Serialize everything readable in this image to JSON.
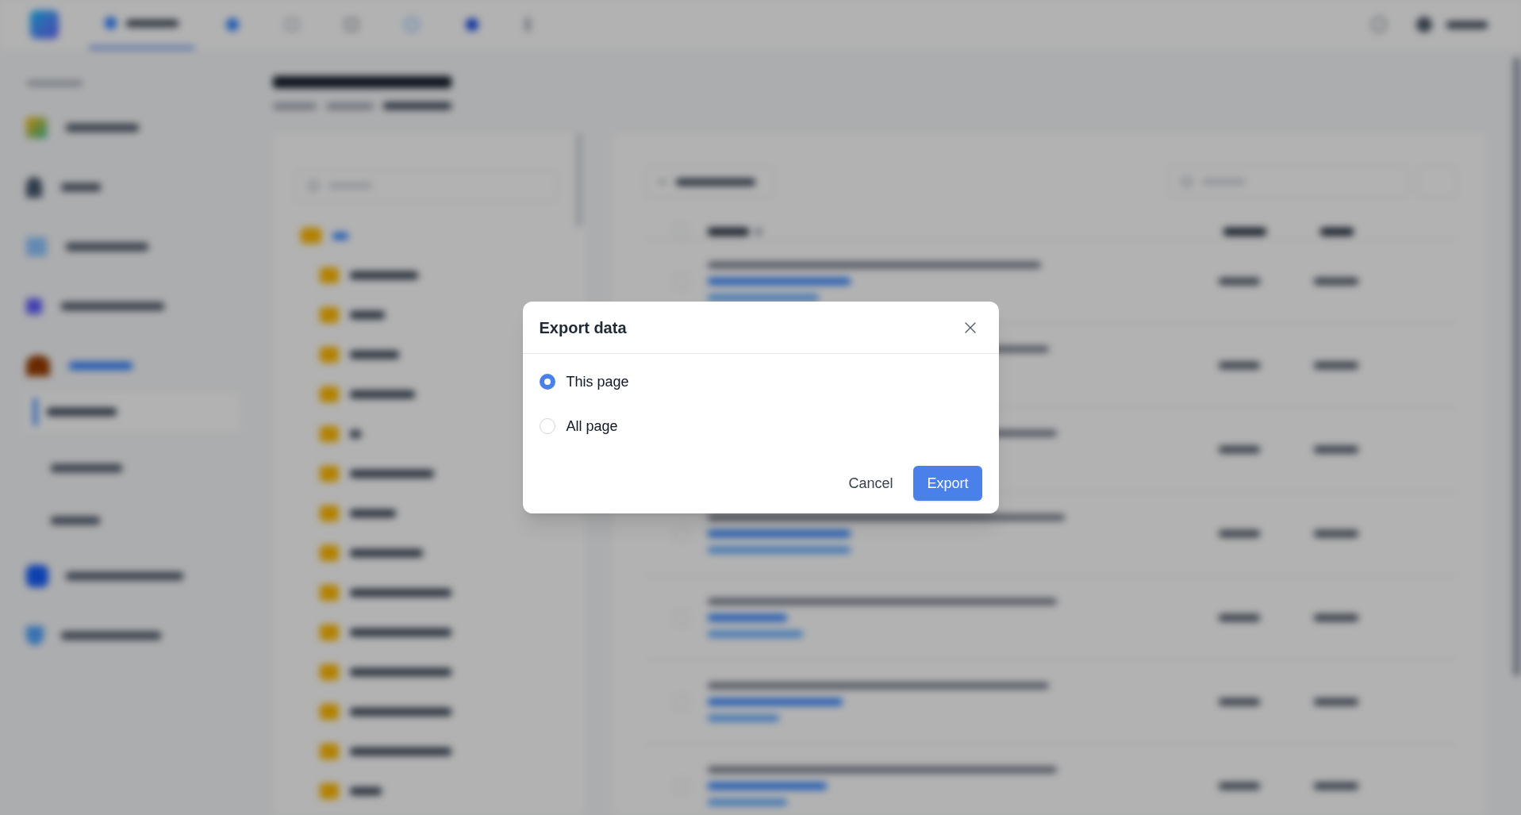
{
  "dialog": {
    "title": "Export data",
    "options": [
      {
        "label": "This page",
        "selected": true
      },
      {
        "label": "All page",
        "selected": false
      }
    ],
    "buttons": [
      {
        "label": "Cancel",
        "kind": "secondary"
      },
      {
        "label": "Export",
        "kind": "primary"
      }
    ]
  }
}
